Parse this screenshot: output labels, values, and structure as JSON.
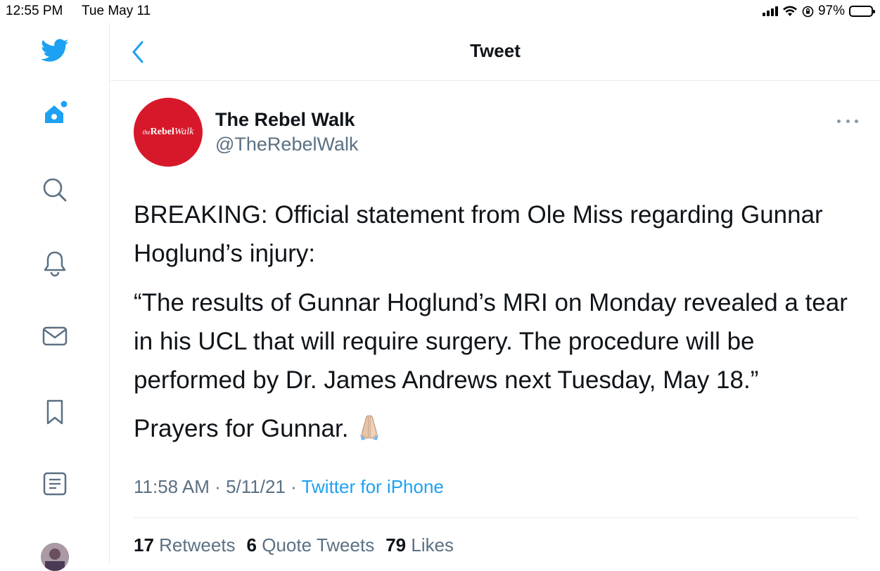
{
  "status_bar": {
    "time": "12:55 PM",
    "date": "Tue May 11",
    "battery": "97%",
    "battery_level": 0.97
  },
  "header": {
    "title": "Tweet"
  },
  "sidebar": {
    "items": [
      {
        "icon": "twitter-logo-icon"
      },
      {
        "icon": "home-icon"
      },
      {
        "icon": "search-icon"
      },
      {
        "icon": "notifications-bell-icon"
      },
      {
        "icon": "messages-envelope-icon"
      },
      {
        "icon": "bookmark-icon"
      },
      {
        "icon": "lists-icon"
      },
      {
        "icon": "profile-avatar"
      }
    ]
  },
  "tweet": {
    "avatar_text": {
      "prefix": "the",
      "bold": "Rebel",
      "italic": "Walk"
    },
    "author_name": "The Rebel Walk",
    "author_handle": "@TheRebelWalk",
    "paragraphs": [
      "BREAKING: Official statement from Ole Miss regarding Gunnar Hoglund’s injury:",
      "“The results of Gunnar Hoglund’s MRI on Monday revealed a tear in his UCL that will require surgery. The procedure will be performed by Dr. James Andrews next Tuesday, May 18.”",
      "Prayers for Gunnar."
    ],
    "time": "11:58 AM",
    "date": "5/11/21",
    "separator": "·",
    "source": "Twitter for iPhone",
    "retweets_count": "17",
    "retweets_label": "Retweets",
    "quote_tweets_count": "6",
    "quote_tweets_label": "Quote Tweets",
    "likes_count": "79",
    "likes_label": "Likes"
  },
  "colors": {
    "accent": "#1da1f2",
    "avatar_bg": "#d7182a",
    "muted": "#5b7083",
    "text": "#0f1419"
  }
}
